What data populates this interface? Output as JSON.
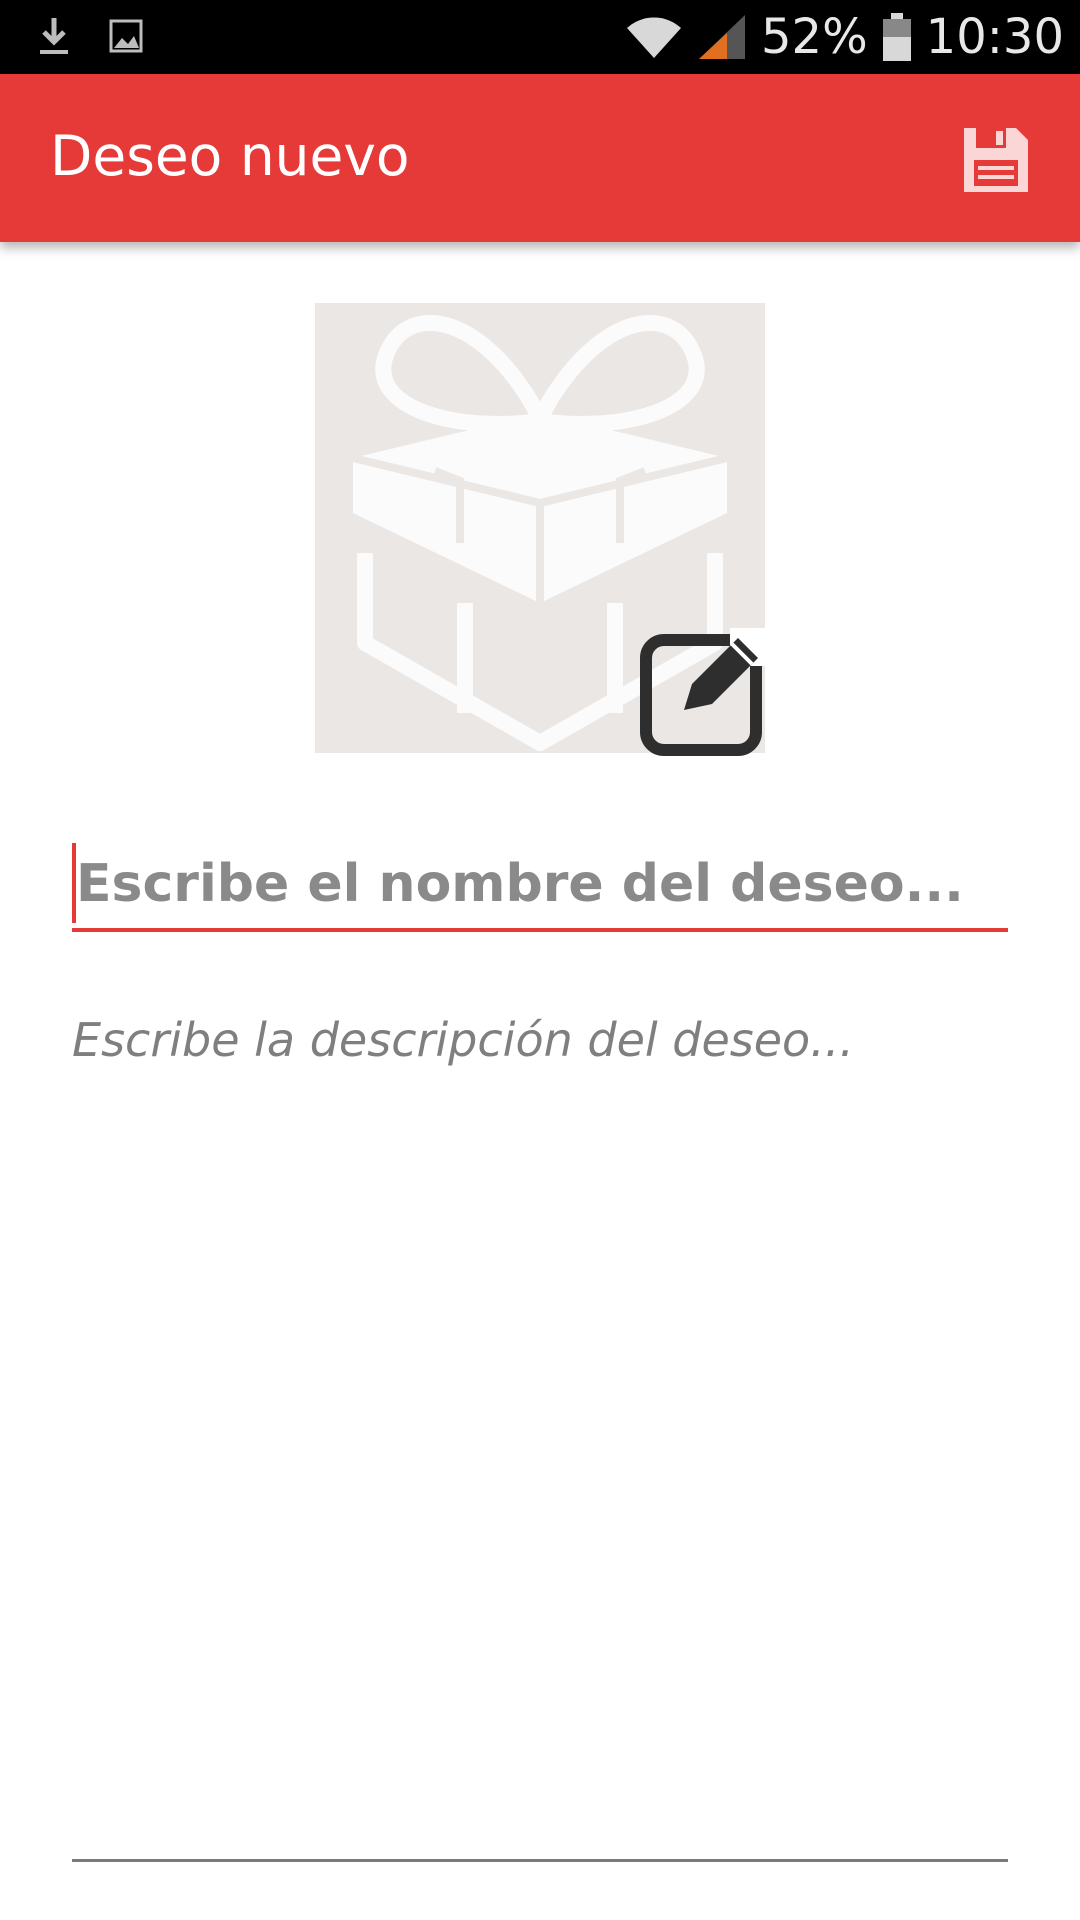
{
  "status_bar": {
    "battery_percent": "52%",
    "time": "10:30",
    "icons": [
      "download-icon",
      "image-icon",
      "wifi-icon",
      "signal-icon",
      "battery-icon"
    ]
  },
  "toolbar": {
    "title": "Deseo nuevo",
    "save_icon": "floppy-disk-icon",
    "background_color": "#e53a38"
  },
  "image": {
    "placeholder_icon": "gift-box-icon",
    "edit_icon": "edit-square-pencil-icon"
  },
  "form": {
    "name_placeholder": "Escribe el nombre del deseo...",
    "name_value": "",
    "description_placeholder": "Escribe la descripción del deseo...",
    "description_value": "",
    "accent_color": "#e53a38"
  }
}
